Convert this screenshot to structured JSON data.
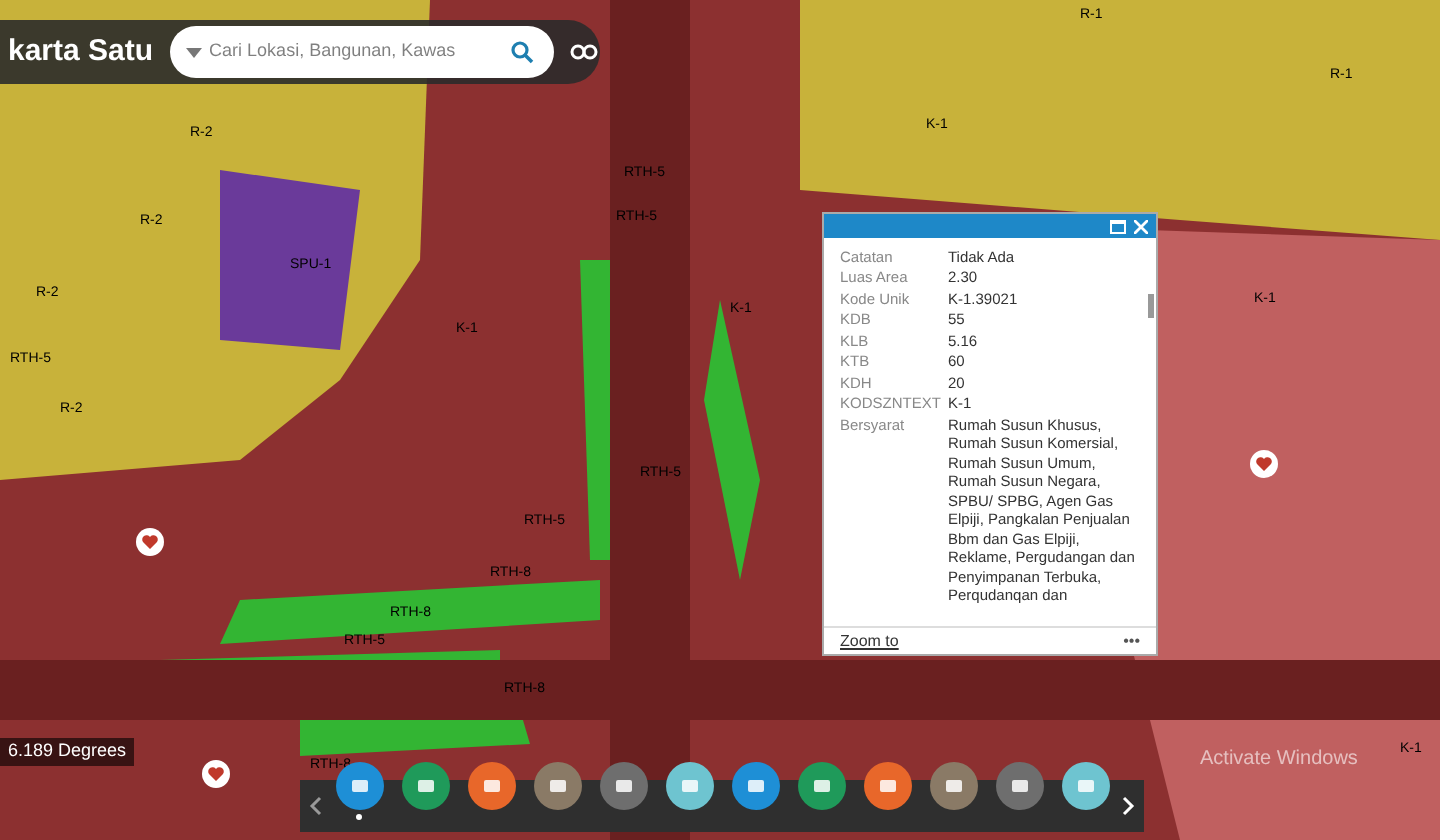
{
  "header": {
    "title": "karta Satu",
    "search": {
      "placeholder": "Cari Lokasi, Bangunan, Kawas"
    }
  },
  "map_labels": [
    "R-2",
    "R-2",
    "R-2",
    "RTH-5",
    "R-2",
    "SPU-1",
    "RTH-5",
    "RTH-5",
    "K-1",
    "K-1",
    "RTH-5",
    "RTH-5",
    "RTH-8",
    "RTH-8",
    "RTH-5",
    "RTH-8",
    "RTH-8",
    "R-1",
    "R-1",
    "K-1",
    "K-1",
    "K-1"
  ],
  "popup": {
    "rows": [
      {
        "label": "Catatan",
        "value": "Tidak Ada"
      },
      {
        "label": "Luas Area",
        "value": "2.30"
      },
      {
        "label": "Kode Unik",
        "value": "K-1.39021"
      },
      {
        "label": "KDB",
        "value": "55"
      },
      {
        "label": "KLB",
        "value": "5.16"
      },
      {
        "label": "KTB",
        "value": "60"
      },
      {
        "label": "KDH",
        "value": "20"
      },
      {
        "label": "KODSZNTEXT",
        "value": "K-1"
      },
      {
        "label": "Bersyarat",
        "value": "Rumah Susun Khusus, Rumah Susun Komersial, Rumah Susun Umum, Rumah Susun Negara, SPBU/ SPBG, Agen Gas Elpiji, Pangkalan Penjualan Bbm dan Gas Elpiji, Reklame, Pergudangan dan Penyimpanan Terbuka, Perqudanqan dan"
      }
    ],
    "zoom_link": "Zoom to",
    "more": "•••"
  },
  "scale": "6.189 Degrees",
  "watermark": "Activate Windows",
  "toolbar": [
    {
      "color": "#1e8fd6",
      "selected": true
    },
    {
      "color": "#1f9a5a",
      "selected": false
    },
    {
      "color": "#e8672a",
      "selected": false
    },
    {
      "color": "#8a7a66",
      "selected": false
    },
    {
      "color": "#6e6e6e",
      "selected": false
    },
    {
      "color": "#6ec4d0",
      "selected": false
    },
    {
      "color": "#1e8fd6",
      "selected": false
    },
    {
      "color": "#1f9a5a",
      "selected": false
    },
    {
      "color": "#e8672a",
      "selected": false
    },
    {
      "color": "#8a7a66",
      "selected": false
    },
    {
      "color": "#6e6e6e",
      "selected": false
    },
    {
      "color": "#6ec4d0",
      "selected": false
    }
  ]
}
